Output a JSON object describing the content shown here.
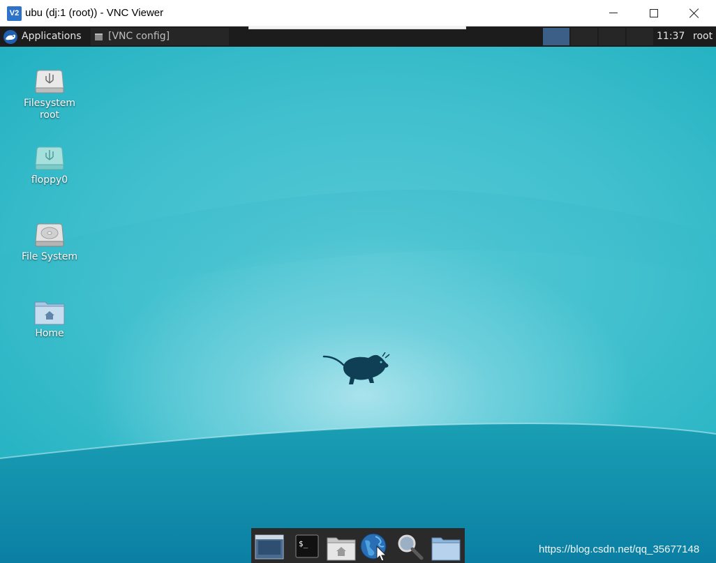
{
  "titlebar": {
    "app_icon": "VNC-Viewer-icon",
    "title": "ubu (dj:1 (root)) - VNC Viewer",
    "controls": [
      "minimize-icon",
      "maximize-icon",
      "close-icon"
    ]
  },
  "panel": {
    "applications_label": "Applications",
    "task_label": "[VNC config]",
    "clock": "11:37",
    "user": "root",
    "workspace_active_color": "#3b5f86"
  },
  "desktop": {
    "icons": [
      {
        "label_line1": "Filesystem",
        "label_line2": "root",
        "icon": "usb-drive-icon"
      },
      {
        "label": "floppy0",
        "icon": "usb-drive-icon"
      },
      {
        "label": "File System",
        "icon": "hard-disk-icon"
      },
      {
        "label": "Home",
        "icon": "home-folder-icon"
      }
    ],
    "background_color": "#3fbfcd"
  },
  "dock": {
    "items": [
      "show-desktop-icon",
      "terminal-icon",
      "file-manager-icon",
      "web-browser-icon",
      "app-finder-icon",
      "folder-icon"
    ],
    "terminal_glyph": "$_"
  },
  "watermark": "https://blog.csdn.net/qq_35677148"
}
